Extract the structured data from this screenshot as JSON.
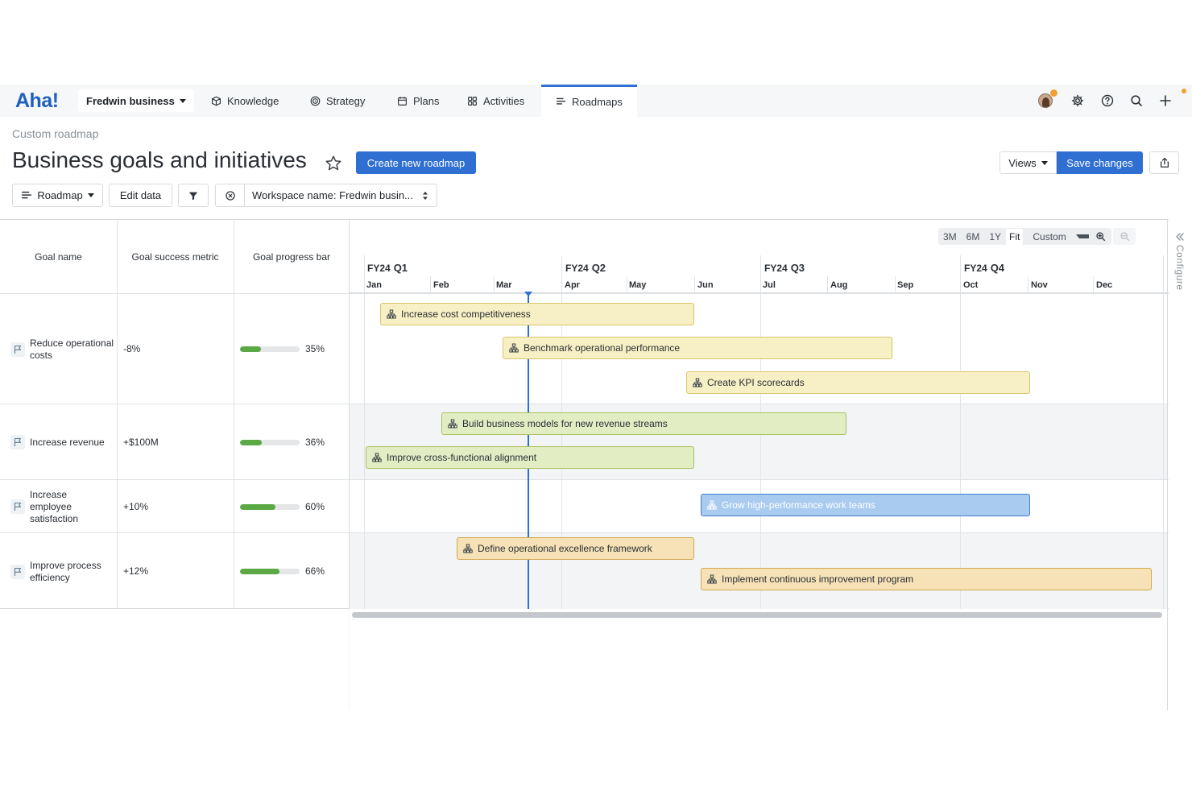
{
  "nav": {
    "logo": "Aha!",
    "workspace": "Fredwin business",
    "items": [
      {
        "label": "Knowledge",
        "icon": "cube-icon"
      },
      {
        "label": "Strategy",
        "icon": "target-icon"
      },
      {
        "label": "Plans",
        "icon": "calendar-icon"
      },
      {
        "label": "Activities",
        "icon": "grid-icon"
      },
      {
        "label": "Roadmaps",
        "icon": "roadmap-icon",
        "active": true
      }
    ]
  },
  "header": {
    "breadcrumb": "Custom roadmap",
    "title": "Business goals and initiatives",
    "create_button": "Create new roadmap",
    "views_button": "Views",
    "save_button": "Save changes"
  },
  "toolbar": {
    "roadmap_button": "Roadmap",
    "edit_button": "Edit data",
    "filter_value": "Workspace name: Fredwin busin..."
  },
  "table": {
    "headers": [
      "Goal name",
      "Goal success metric",
      "Goal progress bar"
    ],
    "rows": [
      {
        "goal": "Reduce operational costs",
        "metric": "-8%",
        "progress": 0.35,
        "progress_label": "35%"
      },
      {
        "goal": "Increase revenue",
        "metric": "+$100M",
        "progress": 0.36,
        "progress_label": "36%"
      },
      {
        "goal": "Increase employee satisfaction",
        "metric": "+10%",
        "progress": 0.6,
        "progress_label": "60%"
      },
      {
        "goal": "Improve process efficiency",
        "metric": "+12%",
        "progress": 0.66,
        "progress_label": "66%"
      }
    ]
  },
  "timeline": {
    "zoom_options": [
      "3M",
      "6M",
      "1Y",
      "Fit",
      "Custom"
    ],
    "zoom_selected": "Fit",
    "quarters": [
      {
        "fy": "FY24",
        "q": "Q1"
      },
      {
        "fy": "FY24",
        "q": "Q2"
      },
      {
        "fy": "FY24",
        "q": "Q3"
      },
      {
        "fy": "FY24",
        "q": "Q4"
      }
    ],
    "months": [
      "Jan",
      "Feb",
      "Mar",
      "Apr",
      "May",
      "Jun",
      "Jul",
      "Aug",
      "Sep",
      "Oct",
      "Nov",
      "Dec"
    ],
    "bars": [
      {
        "label": "Increase cost competitiveness",
        "color": "#f7f0c4",
        "border": "#d9c56a"
      },
      {
        "label": "Benchmark operational performance",
        "color": "#f7f0c4",
        "border": "#d9c56a"
      },
      {
        "label": "Create KPI scorecards",
        "color": "#f7f0c4",
        "border": "#d9c56a"
      },
      {
        "label": "Build business models for new revenue streams",
        "color": "#e2edc4",
        "border": "#a9c060"
      },
      {
        "label": "Improve cross-functional alignment",
        "color": "#e2edc4",
        "border": "#a9c060"
      },
      {
        "label": "Grow high-performance work teams",
        "color": "#a9cbef",
        "border": "#3f7fcf"
      },
      {
        "label": "Define operational excellence framework",
        "color": "#f6e2b6",
        "border": "#d3a94f"
      },
      {
        "label": "Implement continuous improvement program",
        "color": "#f6e2b6",
        "border": "#d3a94f"
      }
    ]
  },
  "configure_label": "Configure"
}
